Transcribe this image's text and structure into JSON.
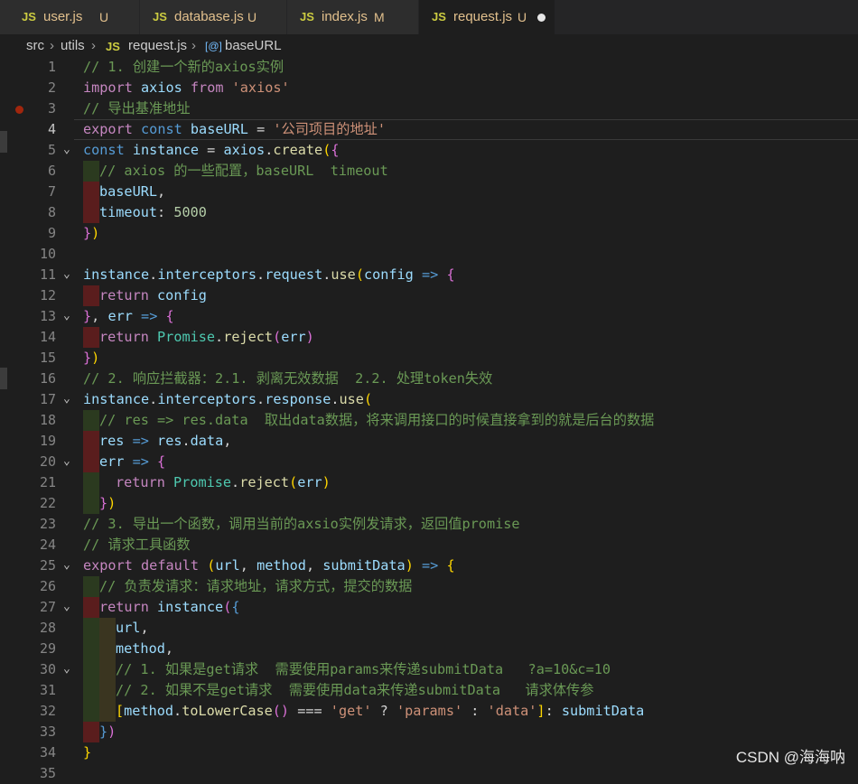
{
  "tabs": [
    {
      "lang": "JS",
      "name": "user.js",
      "status": "U"
    },
    {
      "lang": "JS",
      "name": "database.js",
      "status": "U"
    },
    {
      "lang": "JS",
      "name": "index.js",
      "status": "M"
    },
    {
      "lang": "JS",
      "name": "request.js",
      "status": "U",
      "active": true,
      "unsaved": true
    }
  ],
  "breadcrumb": {
    "p1": "src",
    "p2": "utils",
    "p3_lang": "JS",
    "p3": "request.js",
    "p4_icon": "variable-icon",
    "p4_icon_glyph": "[@]",
    "p4": "baseURL"
  },
  "lines": {
    "l1": "// 1. 创建一个新的axios实例",
    "l3": "// 导出基准地址",
    "l6": "// axios 的一些配置，baseURL  timeout",
    "l16": "// 2. 响应拦截器：2.1. 剥离无效数据  2.2. 处理token失效",
    "l18": "// res => res.data  取出data数据，将来调用接口的时候直接拿到的就是后台的数据",
    "l23": "// 3. 导出一个函数，调用当前的axsio实例发请求，返回值promise",
    "l24": "// 请求工具函数",
    "l26": "// 负责发请求：请求地址，请求方式，提交的数据",
    "l30": "// 1. 如果是get请求  需要使用params来传递submitData   ?a=10&c=10",
    "l31": "// 2. 如果不是get请求  需要使用data来传递submitData   请求体传参"
  },
  "watermark": "CSDN @海海呐",
  "colors": {
    "keyword": "#569cd6",
    "control": "#c586c0",
    "variable": "#9cdcfe",
    "string": "#ce9178",
    "comment": "#6a9955",
    "number": "#b5cea8",
    "function": "#dcdcaa",
    "class": "#4ec9b0",
    "bracket": "#ffd700"
  }
}
